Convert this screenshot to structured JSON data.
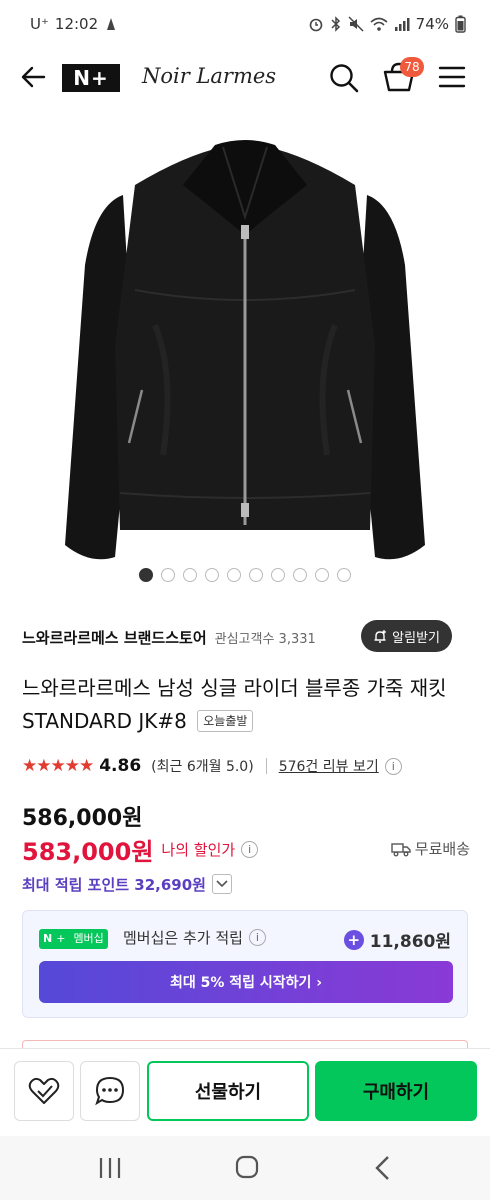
{
  "status_bar": {
    "carrier": "U⁺",
    "time": "12:02",
    "battery": "74%"
  },
  "header": {
    "nplus_logo": "N+",
    "brand_logo": "Noir Larmes",
    "cart_count": "78"
  },
  "gallery": {
    "image_count": 10,
    "active_index": 0
  },
  "store": {
    "name": "느와르라르메스 브랜드스토어",
    "followers": "관심고객수 3,331",
    "alarm_label": "알림받기"
  },
  "product": {
    "title": "느와르라르메스 남성 싱글 라이더 블루종 가죽 재킷 STANDARD JK#8",
    "today_badge": "오늘출발"
  },
  "rating": {
    "stars": "★★★★★",
    "value": "4.86",
    "recent": "(최근 6개월 5.0)",
    "review_link": "576건 리뷰 보기",
    "info_icon": "i"
  },
  "price": {
    "original": "586,000원",
    "discounted": "583,000원",
    "discount_label": "나의 할인가",
    "info_icon": "i",
    "shipping": "무료배송",
    "points": "최대 적립 포인트 32,690원"
  },
  "membership": {
    "badge_n": "N",
    "badge_plus": "+",
    "badge_text": "멤버십",
    "text": "멤버십은 추가 적립",
    "info_icon": "i",
    "points": "11,860원",
    "start_button": "최대 5% 적립 시작하기 ›"
  },
  "actions": {
    "gift": "선물하기",
    "buy": "구매하기"
  },
  "colors": {
    "accent_green": "#03c75a",
    "discount_red": "#e0143c",
    "points_purple": "#5a3fc0",
    "badge_orange": "#f05a3c"
  }
}
